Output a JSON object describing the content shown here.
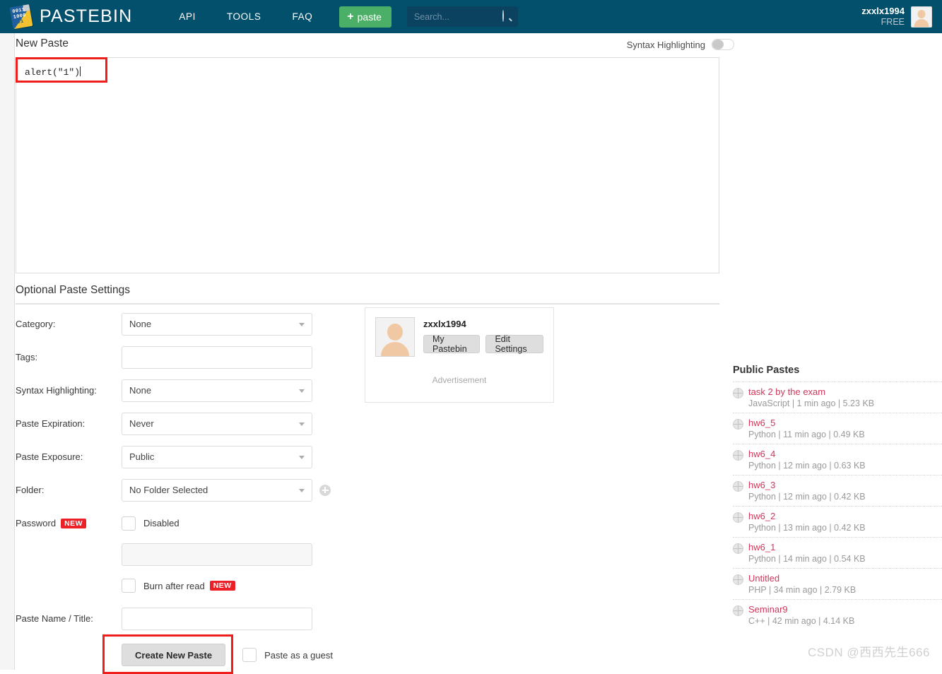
{
  "header": {
    "logo_text": "PASTEBIN",
    "logo_bits": [
      "0011",
      "1000",
      "101"
    ],
    "nav": [
      {
        "label": "API"
      },
      {
        "label": "TOOLS"
      },
      {
        "label": "FAQ"
      }
    ],
    "paste_button": "paste",
    "search": {
      "placeholder": "Search...",
      "value": ""
    },
    "user": {
      "name": "zxxlx1994",
      "tier": "FREE"
    },
    "colors": {
      "bar": "#02506c",
      "paste_button": "#4caf68",
      "search_field": "#0a4260"
    }
  },
  "main": {
    "new_paste_title": "New Paste",
    "syntax_toggle_label": "Syntax Highlighting",
    "syntax_toggle_state": "off",
    "paste_content": "alert(\"1\")",
    "optional_title": "Optional Paste Settings",
    "fields": {
      "category": {
        "label": "Category:",
        "value": "None"
      },
      "tags": {
        "label": "Tags:",
        "value": ""
      },
      "syntax_highlighting": {
        "label": "Syntax Highlighting:",
        "value": "None"
      },
      "paste_expiration": {
        "label": "Paste Expiration:",
        "value": "Never"
      },
      "paste_exposure": {
        "label": "Paste Exposure:",
        "value": "Public"
      },
      "folder": {
        "label": "Folder:",
        "value": "No Folder Selected"
      },
      "password": {
        "label": "Password",
        "badge": "NEW",
        "checkbox_label": "Disabled",
        "value": ""
      },
      "burn_after_read": {
        "label": "Burn after read",
        "badge": "NEW"
      },
      "paste_name": {
        "label": "Paste Name / Title:",
        "value": ""
      }
    },
    "create_button": "Create New Paste",
    "guest_checkbox": "Paste as a guest"
  },
  "user_card": {
    "name": "zxxlx1994",
    "buttons": [
      {
        "label": "My Pastebin"
      },
      {
        "label": "Edit Settings"
      }
    ],
    "ad_label": "Advertisement"
  },
  "sidebar": {
    "title": "Public Pastes",
    "items": [
      {
        "title": "task 2 by the exam",
        "meta": "JavaScript | 1 min ago | 5.23 KB"
      },
      {
        "title": "hw6_5",
        "meta": "Python | 11 min ago | 0.49 KB"
      },
      {
        "title": "hw6_4",
        "meta": "Python | 12 min ago | 0.63 KB"
      },
      {
        "title": "hw6_3",
        "meta": "Python | 12 min ago | 0.42 KB"
      },
      {
        "title": "hw6_2",
        "meta": "Python | 13 min ago | 0.42 KB"
      },
      {
        "title": "hw6_1",
        "meta": "Python | 14 min ago | 0.54 KB"
      },
      {
        "title": "Untitled",
        "meta": "PHP | 34 min ago | 2.79 KB"
      },
      {
        "title": "Seminar9",
        "meta": "C++ | 42 min ago | 4.14 KB"
      }
    ],
    "link_color": "#cf365a"
  },
  "watermark": "CSDN @西西先生666",
  "annotations": {
    "color": "#f01d1d",
    "targets": [
      "paste-text-input",
      "create-new-paste-button"
    ]
  }
}
